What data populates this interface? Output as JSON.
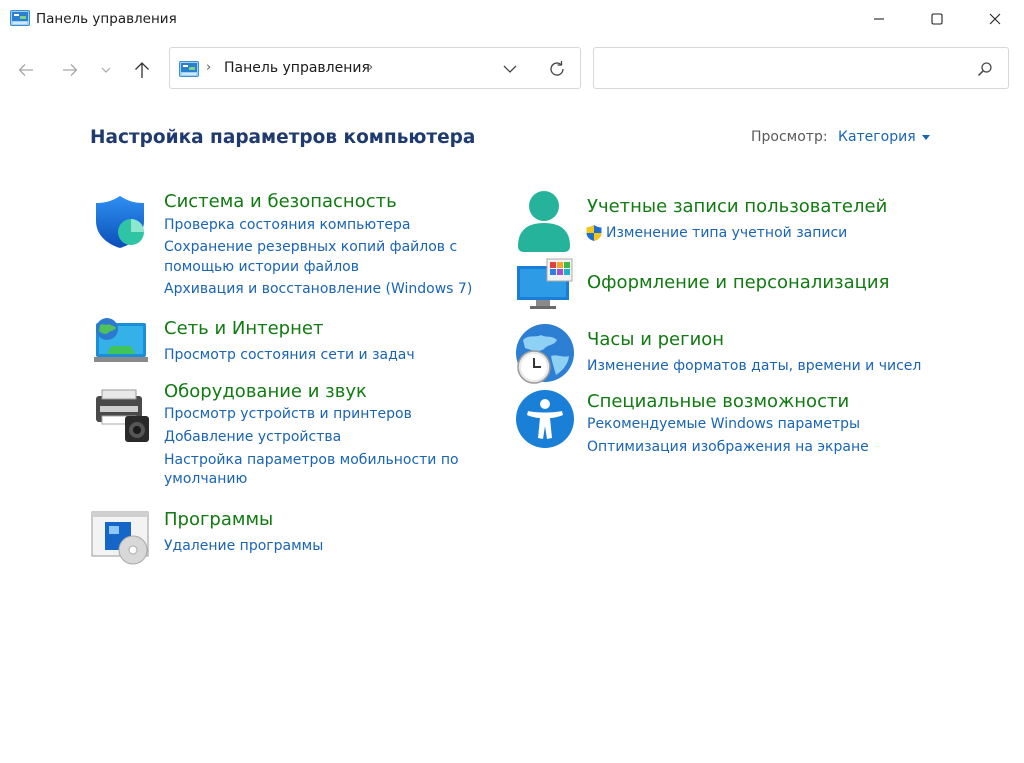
{
  "window": {
    "title": "Панель управления",
    "min_label": "",
    "controls": [
      "minimize-icon",
      "maximize-icon",
      "close-icon"
    ]
  },
  "navbar": {
    "breadcrumb": "Панель управления",
    "search_placeholder": ""
  },
  "main": {
    "heading": "Настройка параметров компьютера",
    "view_label": "Просмотр:",
    "view_value": "Категория"
  },
  "categories": {
    "system": {
      "title": "Система и безопасность",
      "icon": "shield-icon",
      "links": [
        "Проверка состояния компьютера",
        "Сохранение резервных копий файлов с",
        "помощью истории файлов",
        "Архивация и восстановление (Windows 7)"
      ]
    },
    "network": {
      "title": "Сеть и Интернет",
      "icon": "globe-network-icon",
      "links": [
        "Просмотр состояния сети и задач"
      ]
    },
    "hardware": {
      "title": "Оборудование и звук",
      "icon": "printer-speaker-icon",
      "links": [
        "Просмотр устройств и принтеров",
        "Добавление устройства",
        "Настройка параметров мобильности по",
        "умолчанию"
      ]
    },
    "programs": {
      "title": "Программы",
      "icon": "programs-disc-icon",
      "links": [
        "Удаление программы"
      ]
    },
    "users": {
      "title": "Учетные записи пользователей",
      "icon": "user-icon",
      "links": [
        "Изменение типа учетной записи"
      ]
    },
    "appearance": {
      "title": "Оформление и персонализация",
      "icon": "monitor-icon",
      "links": []
    },
    "clock": {
      "title": "Часы и регион",
      "icon": "clock-globe-icon",
      "links": [
        "Изменение форматов даты, времени и чисел"
      ]
    },
    "access": {
      "title": "Специальные возможности",
      "icon": "accessibility-icon",
      "links": [
        "Рекомендуемые Windows параметры",
        "Оптимизация изображения на экране"
      ]
    }
  },
  "colors": {
    "heading": "#1e3a6e",
    "category_title": "#117a11",
    "link": "#1a64b4"
  }
}
